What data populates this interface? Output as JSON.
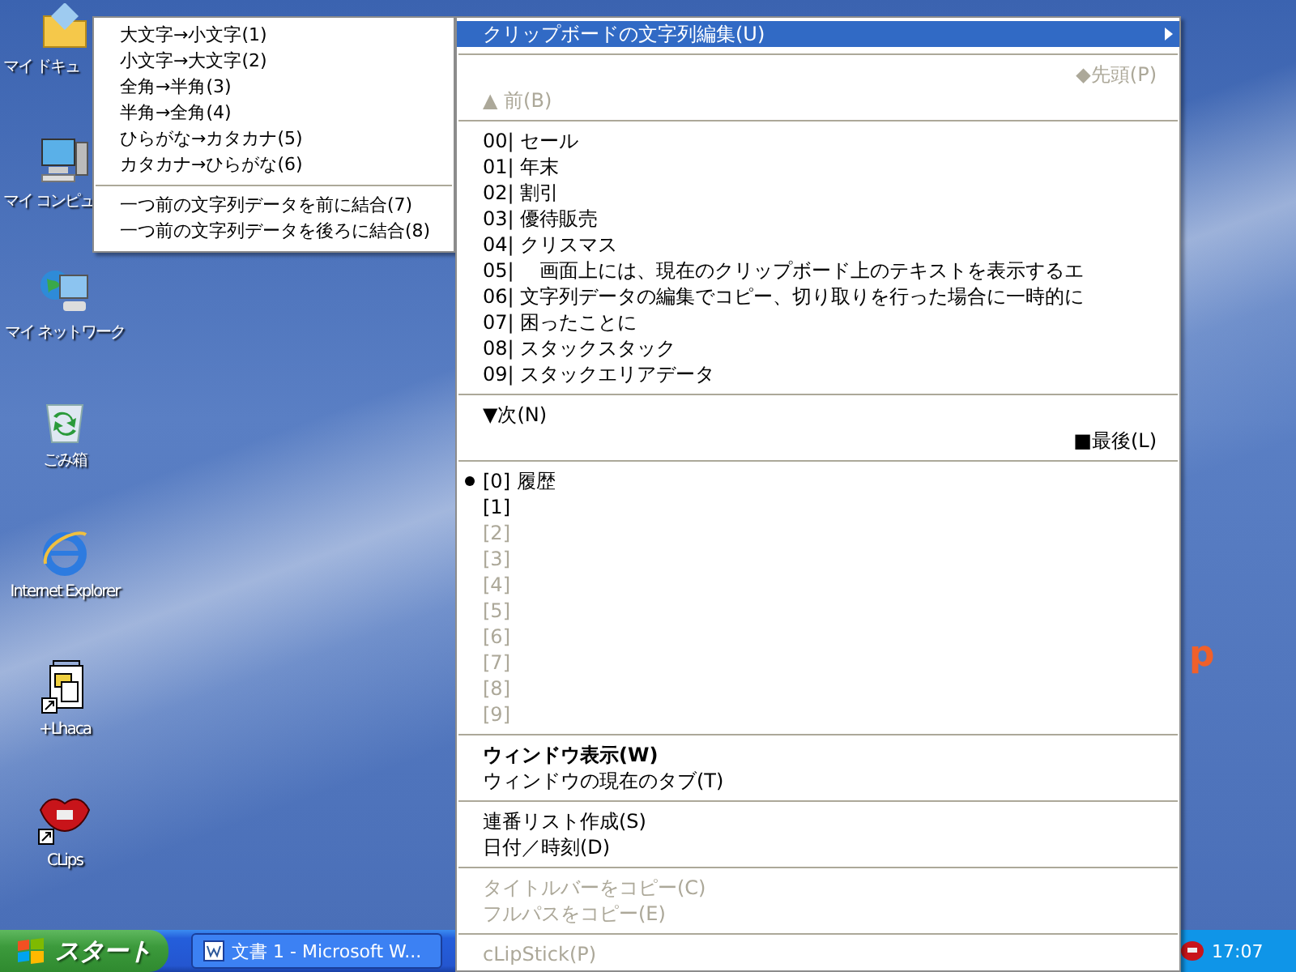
{
  "desktop_icons": [
    {
      "kind": "folder",
      "label": "マイ ドキュ"
    },
    {
      "kind": "computer",
      "label": "マイ コンピュ"
    },
    {
      "kind": "network",
      "label": "マイ ネットワーク"
    },
    {
      "kind": "trash",
      "label": "ごみ箱"
    },
    {
      "kind": "browser",
      "label": "Internet Explorer"
    },
    {
      "kind": "archiver",
      "label": "+Lhaca"
    },
    {
      "kind": "lips",
      "label": "CLips"
    }
  ],
  "wallpaper_logo": "p",
  "submenu": {
    "sections": [
      [
        {
          "label": "大文字→小文字(1)"
        },
        {
          "label": "小文字→大文字(2)"
        },
        {
          "label": "全角→半角(3)"
        },
        {
          "label": "半角→全角(4)"
        },
        {
          "label": "ひらがな→カタカナ(5)"
        },
        {
          "label": "カタカナ→ひらがな(6)"
        }
      ],
      [
        {
          "label": "一つ前の文字列データを前に結合(7)"
        },
        {
          "label": "一つ前の文字列データを後ろに結合(8)"
        }
      ]
    ]
  },
  "main_menu": {
    "sections": [
      [
        {
          "kind": "submenu",
          "label": "クリップボードの文字列編集(U)",
          "selected": true
        }
      ],
      [
        {
          "kind": "nav_right",
          "label": "◆先頭(P)",
          "selected": false,
          "disabled": true
        },
        {
          "kind": "nav_left",
          "label": "▲ 前(B)",
          "selected": false,
          "disabled": true
        }
      ],
      [
        {
          "kind": "entry",
          "label": "00| セール",
          "selected": false,
          "disabled": false
        },
        {
          "kind": "entry",
          "label": "01| 年末",
          "selected": false,
          "disabled": false
        },
        {
          "kind": "entry",
          "label": "02| 割引",
          "selected": false,
          "disabled": false
        },
        {
          "kind": "entry",
          "label": "03| 優待販売",
          "selected": false,
          "disabled": false
        },
        {
          "kind": "entry",
          "label": "04| クリスマス",
          "selected": false,
          "disabled": false
        },
        {
          "kind": "entry",
          "label": "05| 　画面上には、現在のクリップボード上のテキストを表示するエ",
          "selected": false,
          "disabled": false
        },
        {
          "kind": "entry",
          "label": "06| 文字列データの編集でコピー、切り取りを行った場合に一時的に",
          "selected": false,
          "disabled": false
        },
        {
          "kind": "entry",
          "label": "07| 困ったことに",
          "selected": false,
          "disabled": false
        },
        {
          "kind": "entry",
          "label": "08| スタックスタック",
          "selected": false,
          "disabled": false
        },
        {
          "kind": "entry",
          "label": "09| スタックエリアデータ",
          "selected": false,
          "disabled": false
        }
      ],
      [
        {
          "kind": "nav_left",
          "label": "▼次(N)",
          "selected": false,
          "disabled": false
        },
        {
          "kind": "nav_right",
          "label": "■最後(L)",
          "selected": false,
          "disabled": false
        }
      ],
      [
        {
          "kind": "entry",
          "label": "[0] 履歴",
          "checked": true,
          "selected": false,
          "disabled": false
        },
        {
          "kind": "entry",
          "label": "[1]",
          "checked": false,
          "selected": false,
          "disabled": false
        },
        {
          "kind": "entry",
          "label": "[2]",
          "checked": false,
          "selected": false,
          "disabled": true
        },
        {
          "kind": "entry",
          "label": "[3]",
          "checked": false,
          "selected": false,
          "disabled": true
        },
        {
          "kind": "entry",
          "label": "[4]",
          "checked": false,
          "selected": false,
          "disabled": true
        },
        {
          "kind": "entry",
          "label": "[5]",
          "checked": false,
          "selected": false,
          "disabled": true
        },
        {
          "kind": "entry",
          "label": "[6]",
          "checked": false,
          "selected": false,
          "disabled": true
        },
        {
          "kind": "entry",
          "label": "[7]",
          "checked": false,
          "selected": false,
          "disabled": true
        },
        {
          "kind": "entry",
          "label": "[8]",
          "checked": false,
          "selected": false,
          "disabled": true
        },
        {
          "kind": "entry",
          "label": "[9]",
          "checked": false,
          "selected": false,
          "disabled": true
        }
      ],
      [
        {
          "kind": "entry",
          "label": "ウィンドウ表示(W)",
          "bold": true,
          "selected": false,
          "disabled": false
        },
        {
          "kind": "entry",
          "label": "ウィンドウの現在のタブ(T)",
          "bold": false,
          "selected": false,
          "disabled": false
        }
      ],
      [
        {
          "kind": "entry",
          "label": "連番リスト作成(S)",
          "selected": false,
          "disabled": false
        },
        {
          "kind": "entry",
          "label": "日付／時刻(D)",
          "selected": false,
          "disabled": false
        }
      ],
      [
        {
          "kind": "entry",
          "label": "タイトルバーをコピー(C)",
          "selected": false,
          "disabled": true
        },
        {
          "kind": "entry",
          "label": "フルパスをコピー(E)",
          "selected": false,
          "disabled": true
        }
      ],
      [
        {
          "kind": "entry",
          "label": "cLipStick(P)",
          "selected": false,
          "disabled": true
        }
      ]
    ]
  },
  "taskbar": {
    "start": "スタート",
    "tasks": [
      {
        "label": "文書 1 - Microsoft W...",
        "selected": false
      }
    ],
    "clock": "17:07"
  }
}
